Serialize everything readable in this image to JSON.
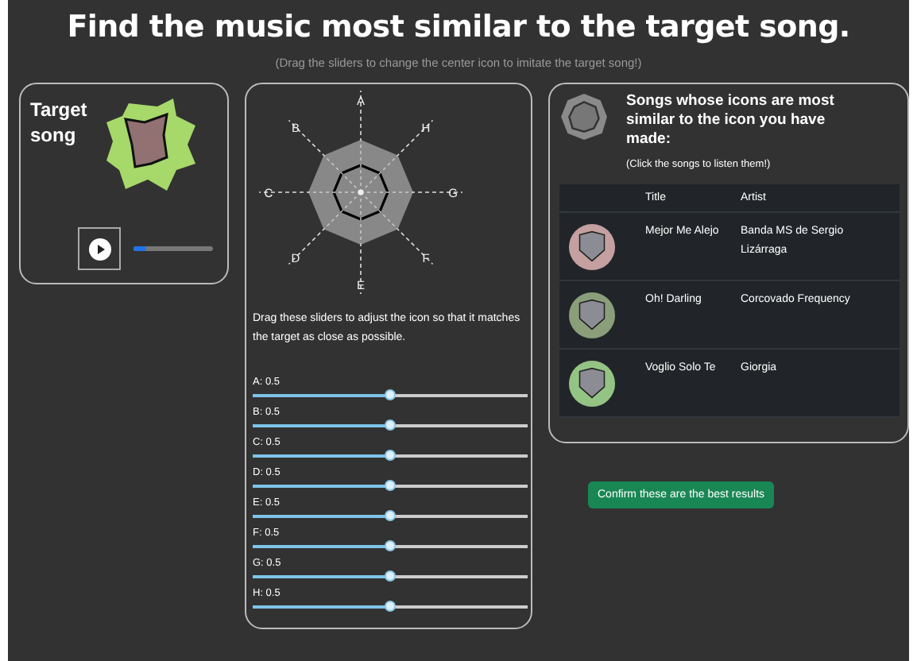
{
  "title": "Find the music most similar to the target song.",
  "subtitle": "(Drag the sliders to change the center icon to imitate the target song!)",
  "target": {
    "label": "Target song",
    "progress": {
      "level": 0.15
    }
  },
  "editor": {
    "axes": [
      "A",
      "B",
      "C",
      "D",
      "E",
      "F",
      "G",
      "H"
    ],
    "instructions": "Drag these sliders to adjust the icon so that it matches the target as close as possible.",
    "sliders": [
      {
        "label": "A: 0.5",
        "level": 0.5
      },
      {
        "label": "B: 0.5",
        "level": 0.5
      },
      {
        "label": "C: 0.5",
        "level": 0.5
      },
      {
        "label": "D: 0.5",
        "level": 0.5
      },
      {
        "label": "E: 0.5",
        "level": 0.5
      },
      {
        "label": "F: 0.5",
        "level": 0.5
      },
      {
        "label": "G: 0.5",
        "level": 0.5
      },
      {
        "label": "H: 0.5",
        "level": 0.5
      }
    ]
  },
  "results": {
    "heading": "Songs whose icons are most similar to the icon you have made:",
    "hint": "(Click the songs to listen them!)",
    "columns": [
      "Title",
      "Artist"
    ],
    "rows": [
      {
        "title": "Mejor Me Alejo",
        "artist": "Banda MS de Sergio Lizárraga",
        "color": "#c4a0a0"
      },
      {
        "title": "Oh! Darling",
        "artist": "Corcovado Frequency",
        "color": "#8a9e7a"
      },
      {
        "title": "Voglio Solo Te",
        "artist": "Giorgia",
        "color": "#94c484"
      }
    ]
  },
  "confirm_button": "Confirm these are the best results"
}
